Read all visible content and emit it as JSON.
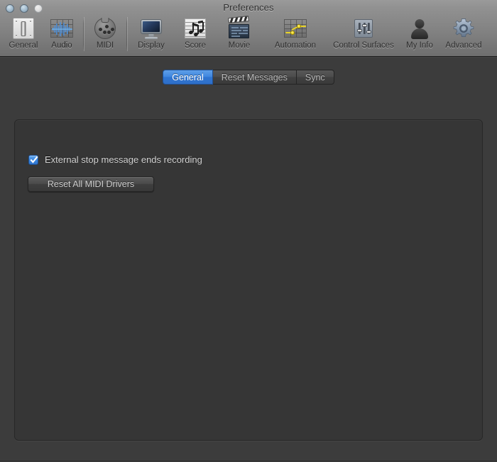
{
  "window": {
    "title": "Preferences",
    "traffic_lights": [
      {
        "name": "close",
        "label": "Close"
      },
      {
        "name": "minimize",
        "label": "Minimize"
      },
      {
        "name": "zoom",
        "label": "Zoom"
      }
    ]
  },
  "toolbar": {
    "items": [
      {
        "id": "general",
        "label": "General",
        "icon": "fader-plate-icon",
        "selected": true
      },
      {
        "id": "audio",
        "label": "Audio",
        "icon": "waveform-icon",
        "selected": false
      },
      {
        "id": "midi",
        "label": "MIDI",
        "icon": "midi-din-connector-icon",
        "selected": false
      },
      {
        "id": "display",
        "label": "Display",
        "icon": "monitor-icon",
        "selected": false
      },
      {
        "id": "score",
        "label": "Score",
        "icon": "music-notes-icon",
        "selected": false
      },
      {
        "id": "movie",
        "label": "Movie",
        "icon": "clapperboard-icon",
        "selected": false
      },
      {
        "id": "automation",
        "label": "Automation",
        "icon": "automation-curve-icon",
        "selected": false
      },
      {
        "id": "control-surfaces",
        "label": "Control Surfaces",
        "icon": "faders-panel-icon",
        "selected": false
      },
      {
        "id": "my-info",
        "label": "My Info",
        "icon": "person-silhouette-icon",
        "selected": false
      },
      {
        "id": "advanced",
        "label": "Advanced",
        "icon": "gear-icon",
        "selected": false
      }
    ]
  },
  "tabs": [
    {
      "id": "general",
      "label": "General",
      "selected": true
    },
    {
      "id": "reset-messages",
      "label": "Reset Messages",
      "selected": false
    },
    {
      "id": "sync",
      "label": "Sync",
      "selected": false
    }
  ],
  "panel": {
    "checkbox": {
      "label": "External stop message ends recording",
      "checked": true
    },
    "button": {
      "label": "Reset All MIDI Drivers"
    }
  },
  "colors": {
    "accent_blue": "#3f86de",
    "toolbar_top": "#9a9a9a",
    "toolbar_bottom": "#6f6f6f",
    "content_bg": "#3c3c3c",
    "panel_bg": "#363636",
    "text_light": "#d2d2d2"
  }
}
